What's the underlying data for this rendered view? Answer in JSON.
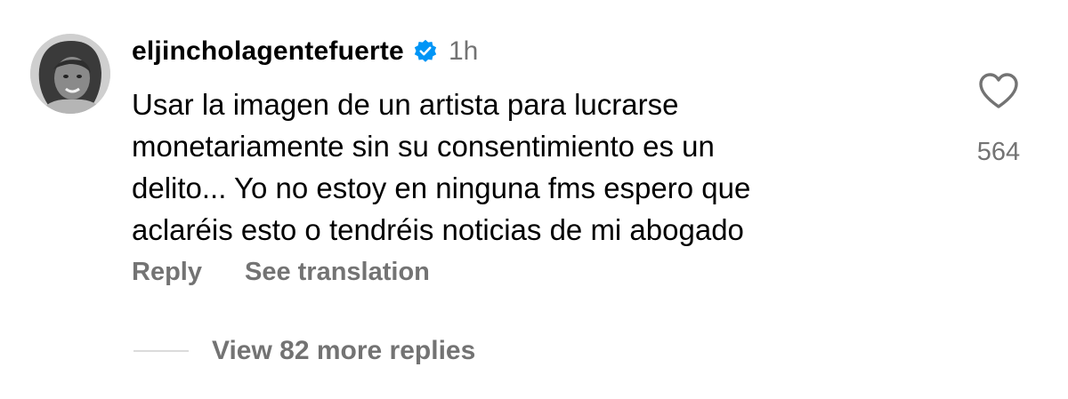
{
  "comment": {
    "username": "eljincholagentefuerte",
    "verified_icon": "verified-badge-icon",
    "timestamp": "1h",
    "text": "Usar la imagen de un artista para lucrarse\nmonetariamente sin su consentimiento es un\ndelito... Yo no estoy en ninguna fms espero que\naclaréis esto o tendréis noticias de mi abogado",
    "actions": {
      "reply_label": "Reply",
      "translate_label": "See translation"
    },
    "likes": {
      "icon": "heart-icon",
      "count": "564"
    },
    "more_replies_label": "View 82 more replies"
  },
  "colors": {
    "primary_text": "#000000",
    "secondary_text": "#737373",
    "verified_blue": "#0095f6",
    "divider": "#dbdbdb"
  }
}
